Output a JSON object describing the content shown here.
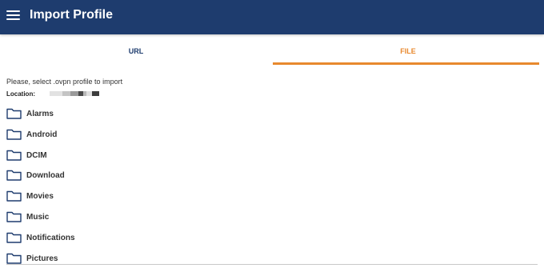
{
  "app_bar": {
    "menu_icon": "hamburger-menu-icon",
    "title": "Import Profile",
    "background": "#1e3c6e"
  },
  "tabs": [
    {
      "label": "URL",
      "selected": false
    },
    {
      "label": "FILE",
      "selected": true
    }
  ],
  "accent_color": "#e8892e",
  "instruction": "Please, select .ovpn profile to import",
  "location": {
    "label": "Location:",
    "path_redacted": true
  },
  "folders": [
    {
      "name": "Alarms",
      "icon": "folder-icon"
    },
    {
      "name": "Android",
      "icon": "folder-icon"
    },
    {
      "name": "DCIM",
      "icon": "folder-icon"
    },
    {
      "name": "Download",
      "icon": "folder-icon"
    },
    {
      "name": "Movies",
      "icon": "folder-icon"
    },
    {
      "name": "Music",
      "icon": "folder-icon"
    },
    {
      "name": "Notifications",
      "icon": "folder-icon"
    },
    {
      "name": "Pictures",
      "icon": "folder-icon"
    }
  ]
}
